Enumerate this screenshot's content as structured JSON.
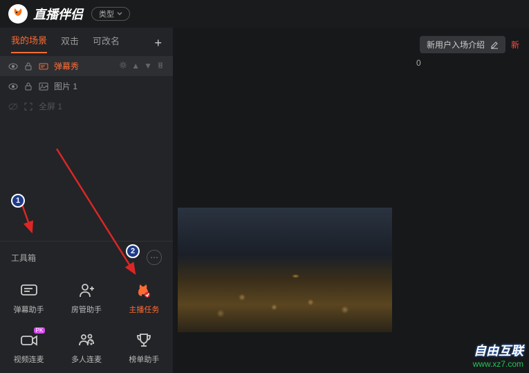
{
  "titlebar": {
    "app_name": "直播伴侣",
    "type_label": "类型"
  },
  "sidebar": {
    "tabs": {
      "my_scene": "我的场景",
      "dblclick": "双击",
      "rename": "可改名"
    },
    "sources": [
      {
        "name": "弹幕秀",
        "style": "orange"
      },
      {
        "name": "图片 1",
        "style": "normal"
      },
      {
        "name": "全屏 1",
        "style": "dim"
      }
    ],
    "toolbox_label": "工具箱",
    "tools": [
      {
        "label": "弹幕助手"
      },
      {
        "label": "房管助手"
      },
      {
        "label": "主播任务",
        "active": true
      },
      {
        "label": "视频连麦",
        "badge": "PK"
      },
      {
        "label": "多人连麦"
      },
      {
        "label": "榜单助手"
      }
    ]
  },
  "content": {
    "header_pill": "新用户入场介绍",
    "red_truncated": "新",
    "counter": "0"
  },
  "annotations": {
    "b1": "1",
    "b2": "2"
  },
  "watermark": {
    "line1": "自由互联",
    "line2": "www.xz7.com"
  }
}
